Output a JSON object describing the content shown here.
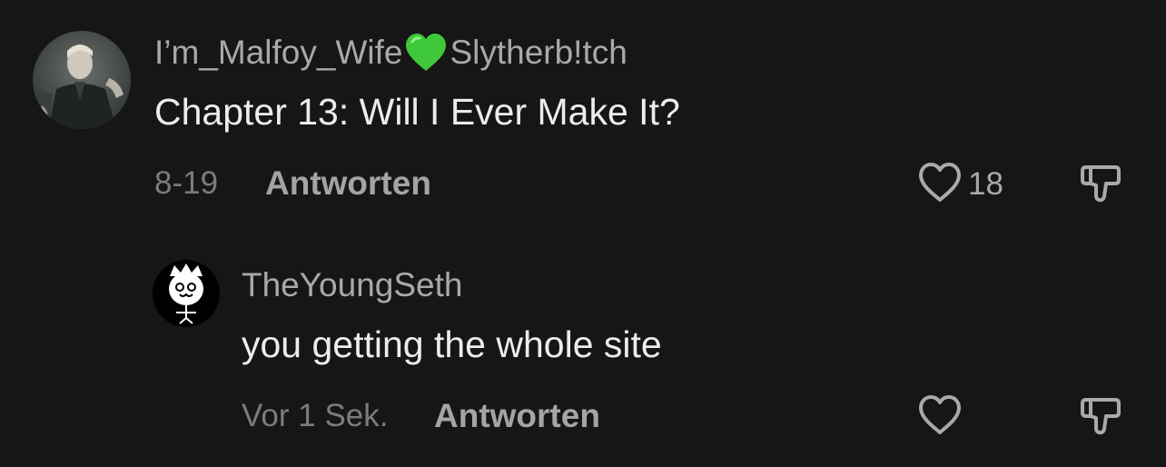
{
  "comments": [
    {
      "username_part1": "I’m_Malfoy_Wife",
      "username_emoji": "green-heart-emoji",
      "username_part2": "Slytherb!tch",
      "text": "Chapter 13: Will I Ever Make It?",
      "date": "8-19",
      "reply_label": "Antworten",
      "like_count": "18"
    },
    {
      "username": "TheYoungSeth",
      "text": "you getting the whole site",
      "date": "Vor 1 Sek.",
      "reply_label": "Antworten"
    }
  ],
  "colors": {
    "background": "#161616",
    "username": "#a9a9a9",
    "text": "#ececec",
    "date": "#7c7c7c",
    "heart_emoji": "#3fc93a"
  }
}
